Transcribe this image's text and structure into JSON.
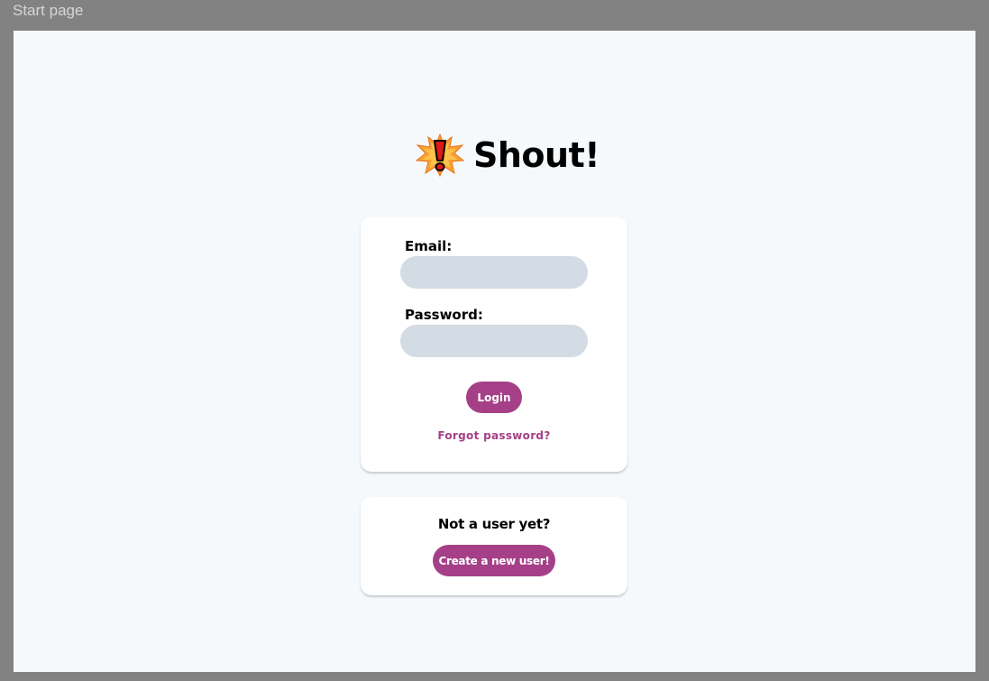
{
  "window": {
    "title": "Start page"
  },
  "brand": {
    "name": "Shout!",
    "logo_icon": "exclamation-burst-icon"
  },
  "login": {
    "email_label": "Email:",
    "email_value": "",
    "password_label": "Password:",
    "password_value": "",
    "login_button": "Login",
    "forgot_link": "Forgot password?"
  },
  "signup": {
    "heading": "Not a user yet?",
    "create_button": "Create a new user!"
  },
  "colors": {
    "accent": "#a54088",
    "input_bg": "#d3dbe4",
    "page_bg": "#f5f9fc",
    "frame_bg": "#828282"
  }
}
